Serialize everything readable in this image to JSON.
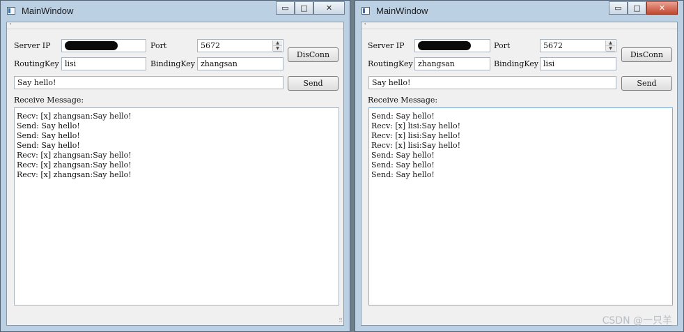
{
  "left_window": {
    "title": "MainWindow",
    "menu_marker": "'",
    "server_ip_label": "Server IP",
    "port_label": "Port",
    "port_value": "5672",
    "routing_key_label": "RoutingKey",
    "routing_key_value": "lisi",
    "binding_key_label": "BindingKey",
    "binding_key_value": "zhangsan",
    "disconnect_button": "DisConn",
    "message_value": "Say hello!",
    "send_button": "Send",
    "receive_label": "Receive Message:",
    "log": [
      "Recv: [x] zhangsan:Say hello!",
      "Send: Say hello!",
      "Send: Say hello!",
      "Send: Say hello!",
      "Recv: [x] zhangsan:Say hello!",
      "Recv: [x] zhangsan:Say hello!",
      "Recv: [x] zhangsan:Say hello!"
    ]
  },
  "right_window": {
    "title": "MainWindow",
    "menu_marker": "'",
    "server_ip_label": "Server IP",
    "port_label": "Port",
    "port_value": "5672",
    "routing_key_label": "RoutingKey",
    "routing_key_value": "zhangsan",
    "binding_key_label": "BindingKey",
    "binding_key_value": "lisi",
    "disconnect_button": "DisConn",
    "message_value": "Say hello!",
    "send_button": "Send",
    "receive_label": "Receive Message:",
    "log": [
      "Send: Say hello!",
      "Recv: [x] lisi:Say hello!",
      "Recv: [x] lisi:Say hello!",
      "Recv: [x] lisi:Say hello!",
      "Send: Say hello!",
      "Send: Say hello!",
      "Send: Say hello!"
    ]
  },
  "caption_glyphs": {
    "minimize": "▭",
    "maximize": "□",
    "close": "✕"
  },
  "icons": [
    "app-window-icon",
    "minimize-icon",
    "maximize-icon",
    "close-icon",
    "spin-up-icon",
    "spin-down-icon",
    "resize-grip-icon"
  ],
  "colors": {
    "frame": "#bcd0e3",
    "close_active": "#c2472f",
    "client": "#f0f0f0"
  },
  "watermark": "CSDN @一只羊_"
}
